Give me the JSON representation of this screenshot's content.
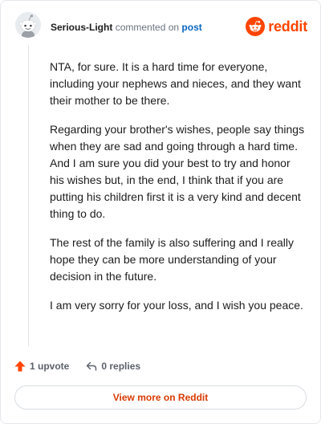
{
  "header": {
    "username": "Serious-Light",
    "action_text": "commented on",
    "post_link": "post",
    "brand_name": "reddit"
  },
  "comment": {
    "paragraphs": [
      "NTA, for sure. It is a hard time for everyone, including your nephews and nieces, and they want their mother to be there.",
      "Regarding your brother's wishes, people say things when they are sad and going through a hard time. And I am sure you did your best to try and honor his wishes but, in the end, I think that if you are putting his children first it is a very kind and decent thing to do.",
      "The rest of the family is also suffering and I really hope they can be more understanding of your decision in the future.",
      "I am very sorry for your loss, and I wish you peace."
    ]
  },
  "actions": {
    "upvote_label": "1 upvote",
    "replies_label": "0 replies"
  },
  "footer": {
    "view_more_label": "View more on Reddit"
  },
  "colors": {
    "brand": "#ff4500",
    "link": "#0a66c2",
    "upvote": "#ff4500"
  },
  "icons": {
    "avatar": "snoo-avatar",
    "brand": "reddit-logo-icon",
    "upvote": "upvote-arrow-icon",
    "reply": "reply-arrow-icon"
  }
}
